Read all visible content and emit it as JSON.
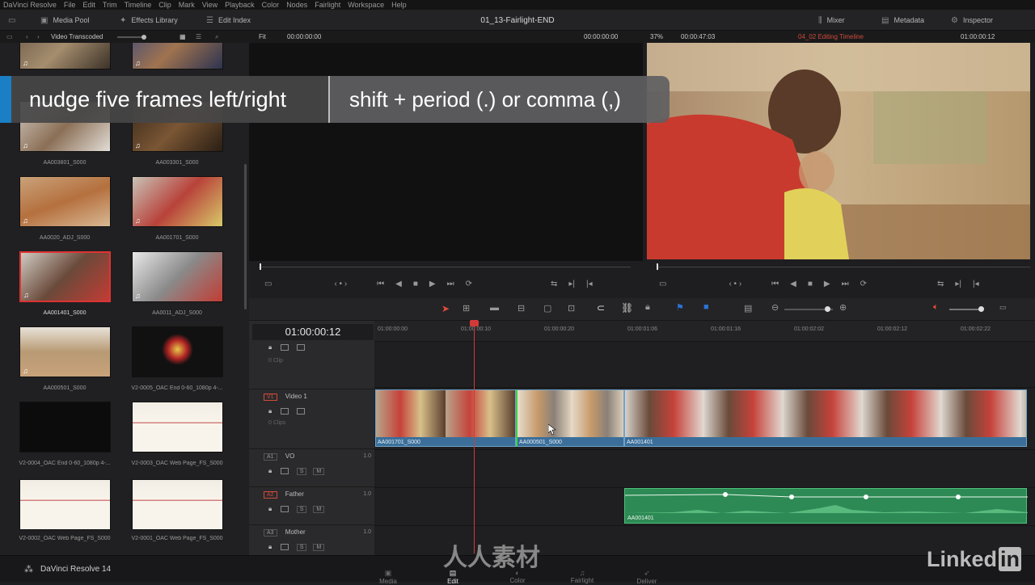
{
  "menu": [
    "DaVinci Resolve",
    "File",
    "Edit",
    "Trim",
    "Timeline",
    "Clip",
    "Mark",
    "View",
    "Playback",
    "Color",
    "Nodes",
    "Fairlight",
    "Workspace",
    "Help"
  ],
  "toolbar": {
    "media_pool": "Media Pool",
    "effects_library": "Effects Library",
    "edit_index": "Edit Index",
    "project_title": "01_13-Fairlight-END",
    "mixer": "Mixer",
    "metadata": "Metadata",
    "inspector": "Inspector"
  },
  "subbar": {
    "bin": "Video Transcoded",
    "fit": "Fit",
    "source_tc": "00:00:00:00",
    "source_dur": "00:00:00:00",
    "zoom": "37%",
    "duration": "00:00:47:03",
    "timeline_name": "04_02 Editing Timeline",
    "timeline_tc": "01:00:00:12"
  },
  "overlay": {
    "left": "nudge five frames left/right",
    "right": "shift + period (.) or comma (,)"
  },
  "clips": [
    {
      "label": "AA003801_S000"
    },
    {
      "label": "AA003301_S000"
    },
    {
      "label": "AA0020_ADJ_S000"
    },
    {
      "label": "AA001701_S000"
    },
    {
      "label": "AA001401_S000"
    },
    {
      "label": "AA0011_ADJ_S000"
    },
    {
      "label": "AA000501_S000"
    },
    {
      "label": "V2-0005_OAC End 0-60_1080p 4-..."
    },
    {
      "label": "V2-0004_OAC End 0-60_1080p 4-..."
    },
    {
      "label": "V2-0003_OAC Web Page_FS_S000"
    },
    {
      "label": "V2-0002_OAC Web Page_FS_S000"
    },
    {
      "label": "V2-0001_OAC Web Page_FS_S000"
    }
  ],
  "timeline": {
    "timecode": "01:00:00:12",
    "ruler": [
      "01:00:00:00",
      "01:00:00:10",
      "01:00:00:20",
      "01:00:01:06",
      "01:00:01:16",
      "01:00:02:02",
      "01:00:02:12",
      "01:00:02:22"
    ],
    "v1_label": "V1",
    "v1_name": "Video 1",
    "v1_clips_count": "0 Clips",
    "v2_clip_count": "0 Clip",
    "a1_label": "A1",
    "a1_name": "VO",
    "a1_level": "1.0",
    "a2_label": "A2",
    "a2_name": "Father",
    "a2_level": "1.0",
    "a3_label": "A3",
    "a3_name": "Mother",
    "a3_level": "1.0",
    "video_clips": [
      "AA001701_S000",
      "AA000501_S000",
      "AA001401"
    ],
    "audio_clip": "AA001401"
  },
  "pages": [
    "Media",
    "Edit",
    "Color",
    "Fairlight",
    "Deliver"
  ],
  "brand": "DaVinci Resolve 14",
  "linkedin": "Linked",
  "linkedin_in": "in",
  "logo_text": "人人素材",
  "colors": {
    "accent": "#1a7fc4",
    "playhead": "#d23a3a",
    "video_clip": "#3b6f9a",
    "audio_clip": "#2d8a55"
  }
}
